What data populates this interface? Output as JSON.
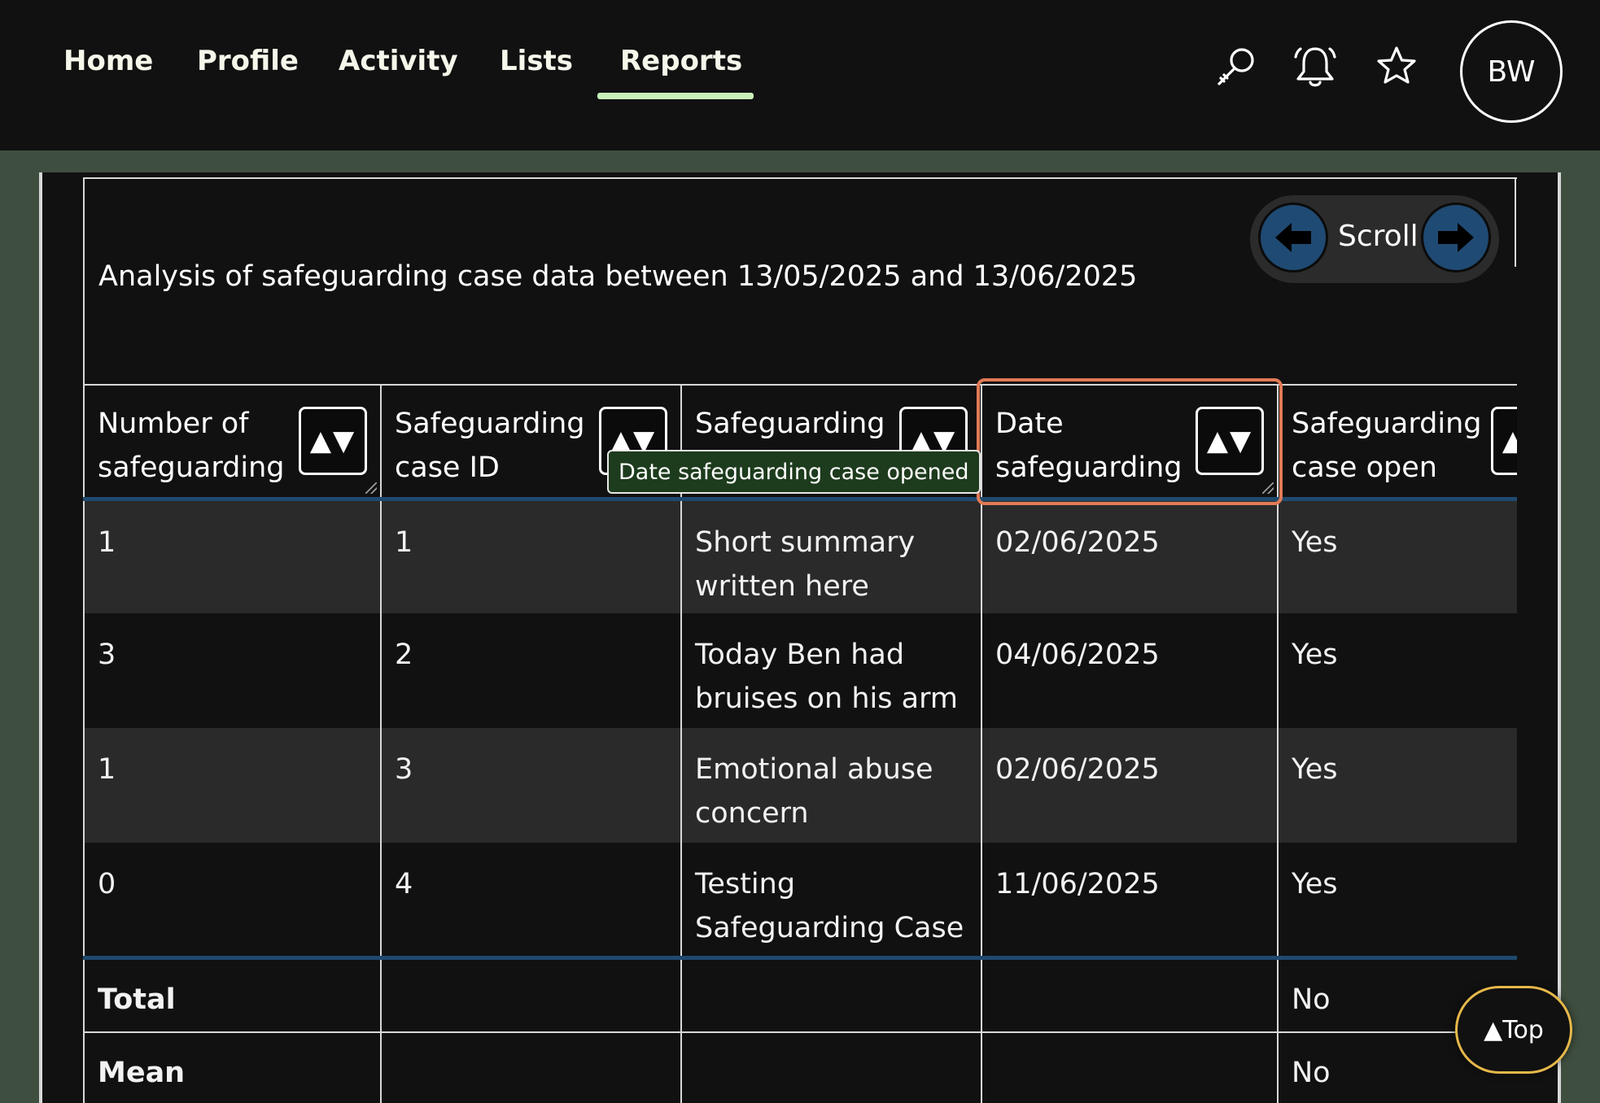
{
  "nav": {
    "items": [
      {
        "label": "Home"
      },
      {
        "label": "Profile"
      },
      {
        "label": "Activity"
      },
      {
        "label": "Lists"
      },
      {
        "label": "Reports"
      }
    ],
    "active": "Reports",
    "icons": [
      "search-icon",
      "bell-icon",
      "star-icon"
    ],
    "avatar_initials": "BW"
  },
  "report": {
    "title": "Analysis of safeguarding case data between 13/05/2025 and 13/06/2025",
    "scroll_label": "Scroll",
    "columns": [
      {
        "label": "Number of safeguarding",
        "sort": "▲▼"
      },
      {
        "label": "Safeguarding case ID",
        "sort": "▲▼"
      },
      {
        "label": "Safeguarding",
        "sort": "▲▼"
      },
      {
        "label": "Date safeguarding",
        "sort": "▲▼"
      },
      {
        "label": "Safeguarding case open",
        "sort": "▲▼"
      }
    ],
    "tooltip": "Date safeguarding case opened",
    "rows": [
      [
        "1",
        "1",
        "Short summary written here",
        "02/06/2025",
        "Yes"
      ],
      [
        "3",
        "2",
        "Today Ben had bruises on his arm",
        "04/06/2025",
        "Yes"
      ],
      [
        "1",
        "3",
        "Emotional abuse concern",
        "02/06/2025",
        "Yes"
      ],
      [
        "0",
        "4",
        "Testing Safeguarding Case",
        "11/06/2025",
        "Yes"
      ]
    ],
    "footer": [
      {
        "label": "Total",
        "last": "No"
      },
      {
        "label": "Mean",
        "last": "No"
      }
    ]
  },
  "top_button": "▲Top",
  "colors": {
    "nav_bg": "#111111",
    "page_bg": "#3f4f3f",
    "active_underline": "#c8f0b8",
    "scroll_button": "#1f4a73",
    "focus_outline": "#e07a55",
    "tooltip_bg": "#1d3b1d",
    "top_button_border": "#e6b84a"
  }
}
